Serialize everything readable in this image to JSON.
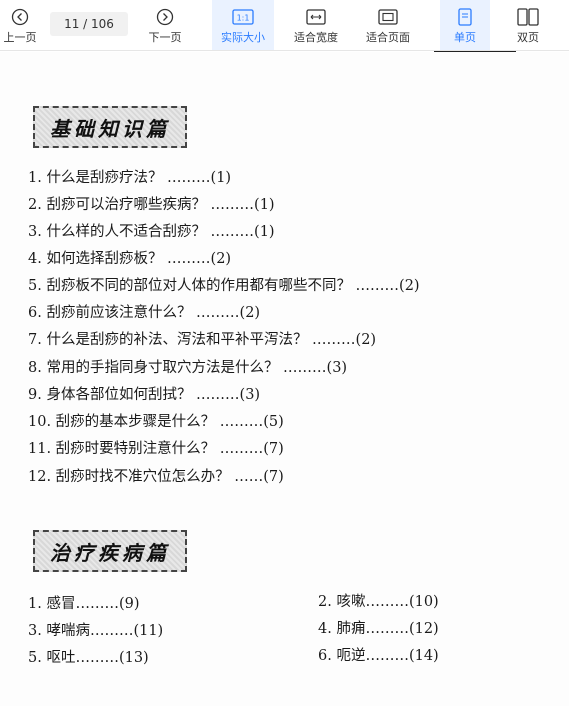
{
  "toolbar": {
    "prev_label": "上一页",
    "page_indicator": "11 / 106",
    "next_label": "下一页",
    "actual_size_label": "实际大小",
    "fit_width_label": "适合宽度",
    "fit_page_label": "适合页面",
    "single_page_label": "单页",
    "double_page_label": "双页",
    "accent_color": "#2b7cff",
    "actual_size_icon_text": "1:1"
  },
  "document": {
    "section1_title": "基础知识篇",
    "section1_items": [
      "1. 什么是刮痧疗法？ ………(1)",
      "2. 刮痧可以治疗哪些疾病？ ………(1)",
      "3. 什么样的人不适合刮痧？ ………(1)",
      "4. 如何选择刮痧板？ ………(2)",
      "5. 刮痧板不同的部位对人体的作用都有哪些不同？ ………(2)",
      "6. 刮痧前应该注意什么？ ………(2)",
      "7. 什么是刮痧的补法、泻法和平补平泻法？ ………(2)",
      "8. 常用的手指同身寸取穴方法是什么？ ………(3)",
      "9. 身体各部位如何刮拭？ ………(3)",
      "10. 刮痧的基本步骤是什么？ ………(5)",
      "11. 刮痧时要特别注意什么？ ………(7)",
      "12. 刮痧时找不准穴位怎么办？ ……(7)"
    ],
    "section2_title": "治疗疾病篇",
    "section2_left": [
      "1. 感冒………(9)",
      "3. 哮喘病………(11)",
      "5. 呕吐………(13)"
    ],
    "section2_right": [
      "2. 咳嗽………(10)",
      "4. 肺痈………(12)",
      "6. 呃逆………(14)"
    ]
  }
}
